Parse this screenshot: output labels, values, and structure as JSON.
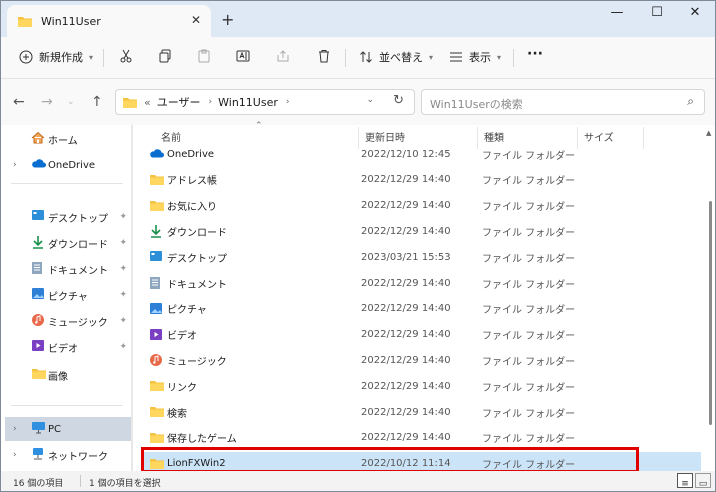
{
  "window": {
    "tab_title": "Win11User",
    "tab_close": "✕",
    "new_tab": "+",
    "minimize": "—",
    "maximize": "☐",
    "close": "✕"
  },
  "toolbar": {
    "new_label": "新規作成",
    "sort_label": "並べ替え",
    "view_label": "表示",
    "more_label": "···"
  },
  "nav": {
    "back": "←",
    "forward": "→",
    "up": "↑"
  },
  "address": {
    "prefix": "«",
    "segments": [
      "ユーザー",
      "Win11User"
    ],
    "separator": "›",
    "dropdown": "⌄",
    "refresh": "↻"
  },
  "search": {
    "placeholder": "Win11Userの検索"
  },
  "sidebar": {
    "items": [
      {
        "label": "ホーム",
        "icon": "home-icon"
      },
      {
        "label": "OneDrive",
        "icon": "cloud-icon"
      },
      {
        "label": "デスクトップ",
        "icon": "desktop-icon",
        "pinned": true
      },
      {
        "label": "ダウンロード",
        "icon": "download-icon",
        "pinned": true
      },
      {
        "label": "ドキュメント",
        "icon": "document-icon",
        "pinned": true
      },
      {
        "label": "ピクチャ",
        "icon": "picture-icon",
        "pinned": true
      },
      {
        "label": "ミュージック",
        "icon": "music-icon",
        "pinned": true
      },
      {
        "label": "ビデオ",
        "icon": "video-icon",
        "pinned": true
      },
      {
        "label": "画像",
        "icon": "folder-icon"
      },
      {
        "label": "PC",
        "icon": "pc-icon",
        "selected": true
      },
      {
        "label": "ネットワーク",
        "icon": "network-icon"
      }
    ],
    "expander": "›",
    "pin_glyph": "✦"
  },
  "columns": {
    "name": "名前",
    "date": "更新日時",
    "type": "種類",
    "size": "サイズ"
  },
  "files": [
    {
      "name": "OneDrive",
      "date": "2022/12/10 12:45",
      "type": "ファイル フォルダー",
      "icon": "cloud-icon"
    },
    {
      "name": "アドレス帳",
      "date": "2022/12/29 14:40",
      "type": "ファイル フォルダー",
      "icon": "folder-icon"
    },
    {
      "name": "お気に入り",
      "date": "2022/12/29 14:40",
      "type": "ファイル フォルダー",
      "icon": "folder-icon"
    },
    {
      "name": "ダウンロード",
      "date": "2022/12/29 14:40",
      "type": "ファイル フォルダー",
      "icon": "download-icon"
    },
    {
      "name": "デスクトップ",
      "date": "2023/03/21 15:53",
      "type": "ファイル フォルダー",
      "icon": "desktop-icon"
    },
    {
      "name": "ドキュメント",
      "date": "2022/12/29 14:40",
      "type": "ファイル フォルダー",
      "icon": "document-icon"
    },
    {
      "name": "ピクチャ",
      "date": "2022/12/29 14:40",
      "type": "ファイル フォルダー",
      "icon": "picture-icon"
    },
    {
      "name": "ビデオ",
      "date": "2022/12/29 14:40",
      "type": "ファイル フォルダー",
      "icon": "video-icon"
    },
    {
      "name": "ミュージック",
      "date": "2022/12/29 14:40",
      "type": "ファイル フォルダー",
      "icon": "music-icon"
    },
    {
      "name": "リンク",
      "date": "2022/12/29 14:40",
      "type": "ファイル フォルダー",
      "icon": "folder-icon"
    },
    {
      "name": "検索",
      "date": "2022/12/29 14:40",
      "type": "ファイル フォルダー",
      "icon": "folder-icon"
    },
    {
      "name": "保存したゲーム",
      "date": "2022/12/29 14:40",
      "type": "ファイル フォルダー",
      "icon": "folder-icon"
    },
    {
      "name": "LionFXWin2",
      "date": "2022/10/12 11:14",
      "type": "ファイル フォルダー",
      "icon": "folder-icon",
      "selected": true
    }
  ],
  "status": {
    "count": "16 個の項目",
    "selected": "1 個の項目を選択"
  },
  "colors": {
    "folder": "#f5c342",
    "accent": "#0067c0",
    "selection": "#cce4f7",
    "highlight_box": "#e00000"
  }
}
